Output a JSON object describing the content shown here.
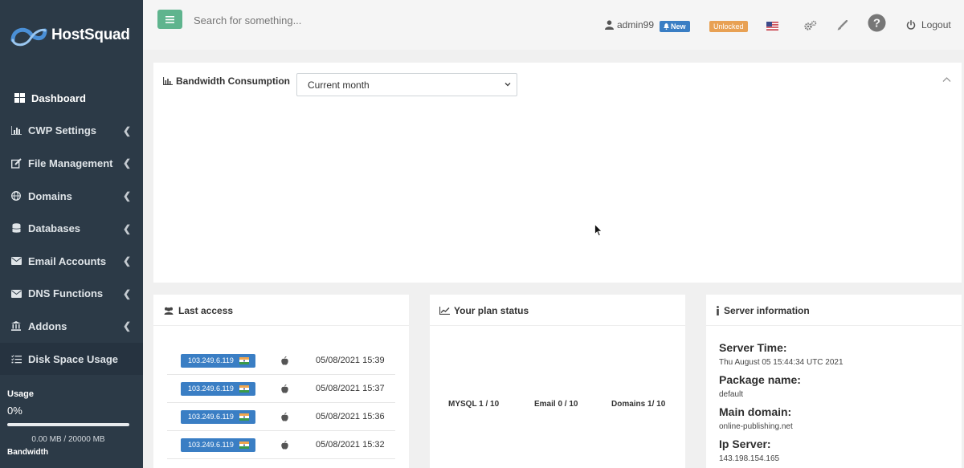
{
  "brand": {
    "name": "HostSquad"
  },
  "header": {
    "search_placeholder": "Search for something...",
    "username": "admin99",
    "new_badge": "New",
    "unlocked_badge": "Unlocked",
    "logout": "Logout"
  },
  "sidebar": {
    "items": [
      {
        "label": "Dashboard",
        "icon": "dashboard-icon",
        "active": true
      },
      {
        "label": "CWP Settings",
        "icon": "bar-chart-icon"
      },
      {
        "label": "File Management",
        "icon": "edit-icon"
      },
      {
        "label": "Domains",
        "icon": "globe-icon"
      },
      {
        "label": "Databases",
        "icon": "database-icon"
      },
      {
        "label": "Email Accounts",
        "icon": "envelope-icon"
      },
      {
        "label": "DNS Functions",
        "icon": "envelope-icon"
      },
      {
        "label": "Addons",
        "icon": "bank-icon"
      },
      {
        "label": "Disk Space Usage",
        "icon": "tasks-icon"
      }
    ],
    "usage": {
      "title": "Usage",
      "percent": "0%",
      "fraction": 0,
      "amount": "0.00 MB / 20000 MB",
      "bandwidth_label": "Bandwidth"
    }
  },
  "bandwidth": {
    "title": "Bandwidth Consumption",
    "selected_period": "Current month"
  },
  "last_access": {
    "title": "Last access",
    "rows": [
      {
        "ip": "103.249.6.119",
        "time": "05/08/2021 15:39"
      },
      {
        "ip": "103.249.6.119",
        "time": "05/08/2021 15:37"
      },
      {
        "ip": "103.249.6.119",
        "time": "05/08/2021 15:36"
      },
      {
        "ip": "103.249.6.119",
        "time": "05/08/2021 15:32"
      }
    ]
  },
  "plan_status": {
    "title": "Your plan status",
    "mysql": "MYSQL 1 / 10",
    "email": "Email 0 / 10",
    "domains": "Domains 1/ 10"
  },
  "server_info": {
    "title": "Server information",
    "server_time_label": "Server Time:",
    "server_time": "Thu August 05 15:44:34 UTC 2021",
    "package_label": "Package name:",
    "package": "default",
    "main_domain_label": "Main domain:",
    "main_domain": "online-publishing.net",
    "ip_label": "Ip Server:",
    "ip": "143.198.154.165"
  },
  "colors": {
    "sidebar": "#2c3a47",
    "accent_green": "#5fb48e",
    "badge_blue": "#3a7ec4",
    "badge_orange": "#e8a154"
  }
}
